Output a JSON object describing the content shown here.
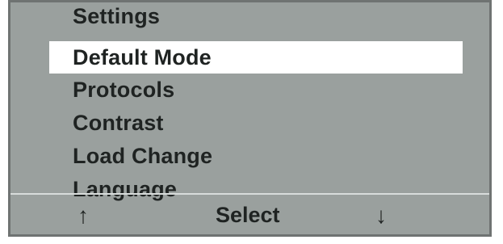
{
  "menu": {
    "title": "Settings",
    "items": [
      {
        "label": "Default Mode",
        "selected": true
      },
      {
        "label": "Protocols",
        "selected": false
      },
      {
        "label": "Contrast",
        "selected": false
      },
      {
        "label": "Load Change",
        "selected": false
      },
      {
        "label": "Language",
        "selected": false
      }
    ]
  },
  "softkeys": {
    "up": "↑",
    "select": "Select",
    "down": "↓"
  },
  "colors": {
    "screen_background": "#9aa09e",
    "highlight": "#ffffff",
    "text": "#1f2322"
  }
}
